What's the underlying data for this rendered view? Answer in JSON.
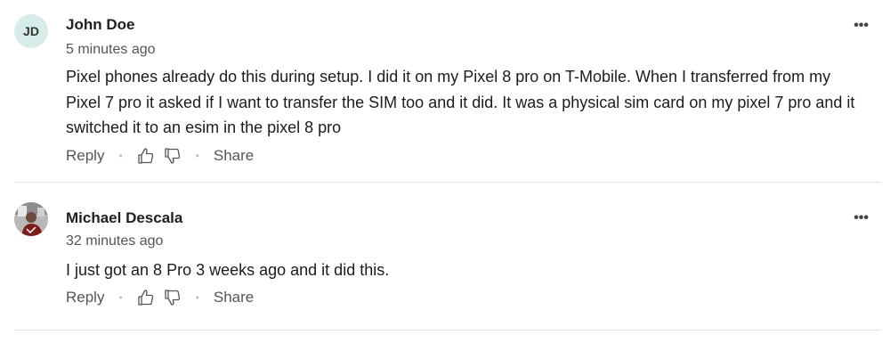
{
  "comments": [
    {
      "avatar_initials": "JD",
      "avatar_bg": "#d6ece9",
      "author": "John Doe",
      "time": "5 minutes ago",
      "body": "Pixel phones already do this during setup. I did it on my Pixel 8 pro on T-Mobile. When I transferred from my Pixel 7 pro it asked if I want to transfer the SIM too and it did. It was a physical sim card on my pixel 7 pro and it switched it to an esim in the pixel 8 pro",
      "reply_label": "Reply",
      "share_label": "Share",
      "more_label": "•••"
    },
    {
      "avatar_icon": "user-photo",
      "author": "Michael Descala",
      "time": "32 minutes ago",
      "body": "I just got an 8 Pro 3 weeks ago and it did this.",
      "reply_label": "Reply",
      "share_label": "Share",
      "more_label": "•••"
    }
  ],
  "icons": {
    "thumbs_up": "thumbs-up-icon",
    "thumbs_down": "thumbs-down-icon"
  }
}
